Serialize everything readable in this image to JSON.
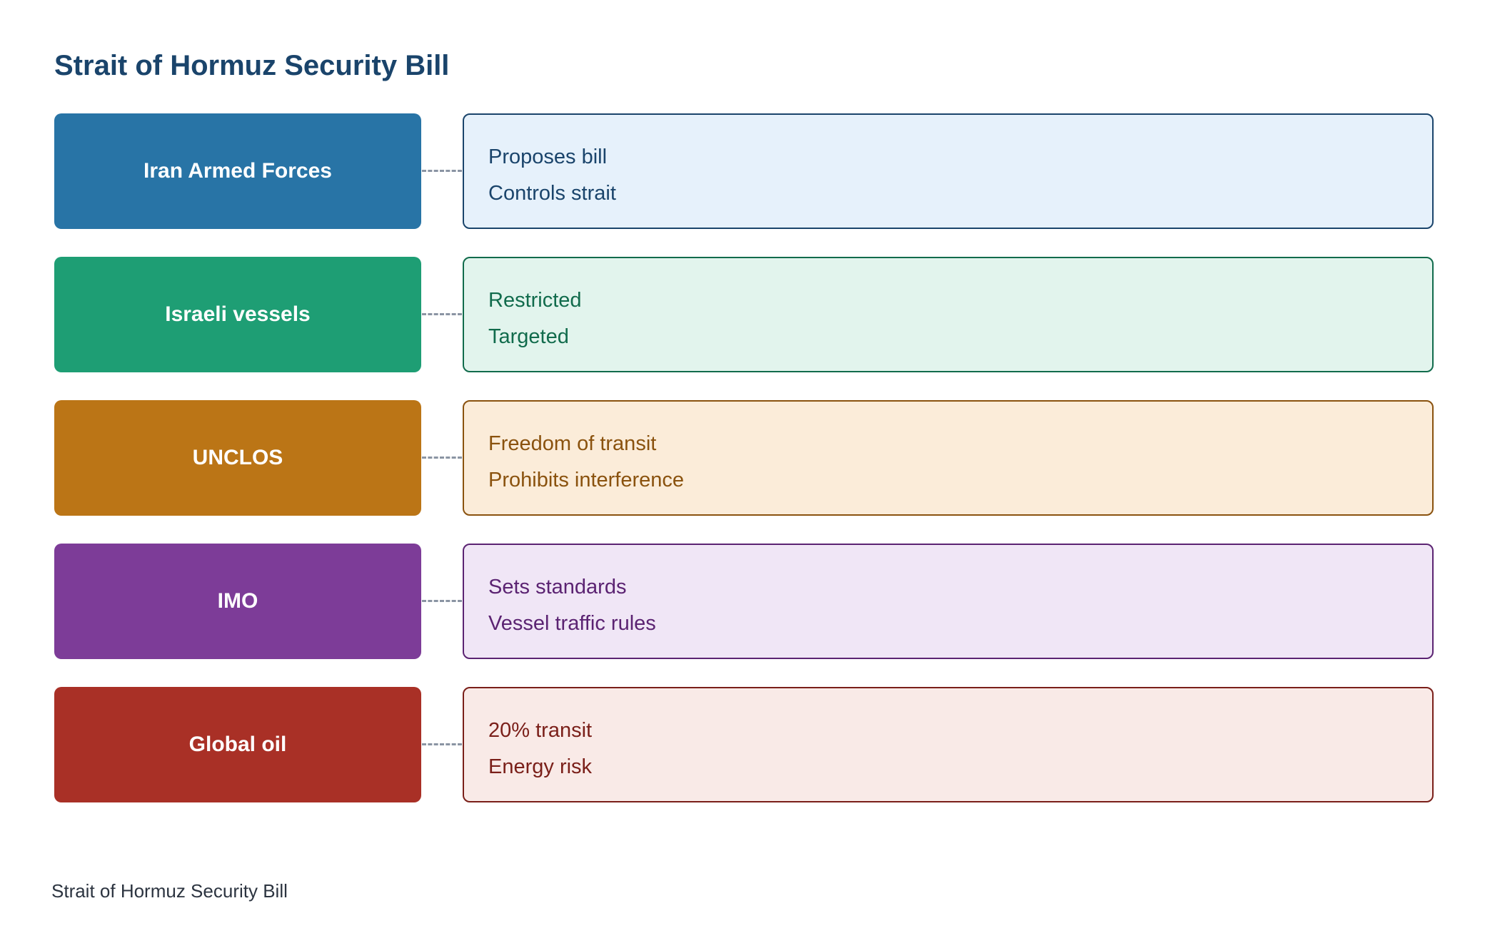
{
  "title": "Strait of Hormuz Security Bill",
  "footer": "Strait of Hormuz Security Bill",
  "rows": [
    {
      "entity": "Iran Armed Forces",
      "details": [
        "Proposes bill",
        "Controls strait"
      ],
      "colors": {
        "fill": "#2874a6",
        "panel_bg": "#e6f1fb",
        "panel_border": "#1a446b",
        "text": "#1a446b"
      }
    },
    {
      "entity": "Israeli vessels",
      "details": [
        "Restricted",
        "Targeted"
      ],
      "colors": {
        "fill": "#1e9e74",
        "panel_bg": "#e2f4ed",
        "panel_border": "#116b4c",
        "text": "#116b4c"
      }
    },
    {
      "entity": "UNCLOS",
      "details": [
        "Freedom of transit",
        "Prohibits interference"
      ],
      "colors": {
        "fill": "#bb7516",
        "panel_bg": "#fbecd9",
        "panel_border": "#8a520e",
        "text": "#8a520e"
      }
    },
    {
      "entity": "IMO",
      "details": [
        "Sets standards",
        "Vessel traffic rules"
      ],
      "colors": {
        "fill": "#7d3c98",
        "panel_bg": "#f0e6f6",
        "panel_border": "#5b2372",
        "text": "#5b2372"
      }
    },
    {
      "entity": "Global oil",
      "details": [
        "20% transit",
        "Energy risk"
      ],
      "colors": {
        "fill": "#a93026",
        "panel_bg": "#f9eae7",
        "panel_border": "#7a1f19",
        "text": "#7a1f19"
      }
    }
  ]
}
